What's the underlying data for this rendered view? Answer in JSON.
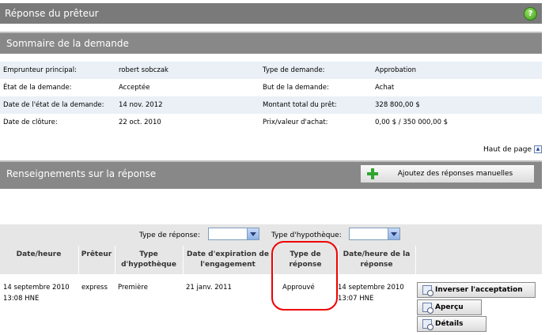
{
  "header": {
    "title": "Réponse du prêteur",
    "help_glyph": "?"
  },
  "summary": {
    "title": "Sommaire de la demande",
    "rows": [
      {
        "label1": "Emprunteur principal:",
        "value1": "robert sobczak",
        "label2": "Type de demande:",
        "value2": "Approbation"
      },
      {
        "label1": "État de la demande:",
        "value1": "Acceptée",
        "label2": "But de la demande:",
        "value2": "Achat"
      },
      {
        "label1": "Date de l'état de la demande:",
        "value1": "14 nov. 2012",
        "label2": "Montant total du prêt:",
        "value2": "328 800,00 $"
      },
      {
        "label1": "Date de clôture:",
        "value1": "22 oct. 2010",
        "label2": "Prix/valeur d'achat:",
        "value2": "0,00 $ / 350 000,00 $"
      }
    ],
    "top_link": "Haut de page",
    "top_glyph": "▲"
  },
  "response_info": {
    "title": "Renseignements sur la réponse",
    "manual_button": "Ajoutez des réponses manuelles"
  },
  "filters": {
    "response_type_label": "Type de réponse:",
    "response_type_value": "",
    "mortgage_type_label": "Type d'hypothèque:",
    "mortgage_type_value": ""
  },
  "table": {
    "headers": {
      "datetime": [
        "Date/heure"
      ],
      "lender": [
        "Prêteur"
      ],
      "type": [
        "Type",
        "d'hypothèque"
      ],
      "expiry": [
        "Date d'expiration de",
        "l'engagement"
      ],
      "response_type": [
        "Type de",
        "réponse"
      ],
      "response_datetime": [
        "Date/heure de la",
        "réponse"
      ]
    },
    "row": {
      "datetime": [
        "14 septembre 2010",
        "13:08 HNE"
      ],
      "lender": "express",
      "type": "Première",
      "expiry": "21 janv. 2011",
      "response_type": "Approuvé",
      "response_datetime": [
        "14 septembre 2010",
        "13:07 HNE"
      ]
    },
    "actions": {
      "reverse": "Inverser l'acceptation",
      "preview": "Aperçu",
      "details": "Détails"
    }
  },
  "colors": {
    "annotation_circle": "#ee0000",
    "row_alt": "#eaf0f6",
    "bar": "#888888"
  }
}
